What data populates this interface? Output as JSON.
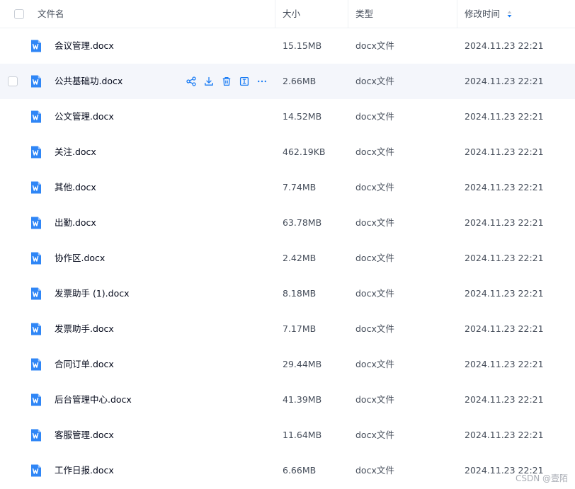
{
  "header": {
    "name_label": "文件名",
    "size_label": "大小",
    "type_label": "类型",
    "mtime_label": "修改时间"
  },
  "colors": {
    "accent": "#1a7cf4",
    "icon_blue": "#2f86f6",
    "hover_row": "#f4f6fb"
  },
  "files": [
    {
      "name": "会议管理.docx",
      "size": "15.15MB",
      "type": "docx文件",
      "mtime": "2024.11.23 22:21"
    },
    {
      "name": "公共基础功.docx",
      "size": "2.66MB",
      "type": "docx文件",
      "mtime": "2024.11.23 22:21"
    },
    {
      "name": "公文管理.docx",
      "size": "14.52MB",
      "type": "docx文件",
      "mtime": "2024.11.23 22:21"
    },
    {
      "name": "关注.docx",
      "size": "462.19KB",
      "type": "docx文件",
      "mtime": "2024.11.23 22:21"
    },
    {
      "name": "其他.docx",
      "size": "7.74MB",
      "type": "docx文件",
      "mtime": "2024.11.23 22:21"
    },
    {
      "name": "出勤.docx",
      "size": "63.78MB",
      "type": "docx文件",
      "mtime": "2024.11.23 22:21"
    },
    {
      "name": "协作区.docx",
      "size": "2.42MB",
      "type": "docx文件",
      "mtime": "2024.11.23 22:21"
    },
    {
      "name": "发票助手 (1).docx",
      "size": "8.18MB",
      "type": "docx文件",
      "mtime": "2024.11.23 22:21"
    },
    {
      "name": "发票助手.docx",
      "size": "7.17MB",
      "type": "docx文件",
      "mtime": "2024.11.23 22:21"
    },
    {
      "name": "合同订单.docx",
      "size": "29.44MB",
      "type": "docx文件",
      "mtime": "2024.11.23 22:21"
    },
    {
      "name": "后台管理中心.docx",
      "size": "41.39MB",
      "type": "docx文件",
      "mtime": "2024.11.23 22:21"
    },
    {
      "name": "客服管理.docx",
      "size": "11.64MB",
      "type": "docx文件",
      "mtime": "2024.11.23 22:21"
    },
    {
      "name": "工作日报.docx",
      "size": "6.66MB",
      "type": "docx文件",
      "mtime": "2024.11.23 22:21"
    }
  ],
  "hover_actions": [
    "share-icon",
    "download-icon",
    "delete-icon",
    "rename-icon",
    "more-icon"
  ],
  "watermark": "CSDN @壹陌"
}
